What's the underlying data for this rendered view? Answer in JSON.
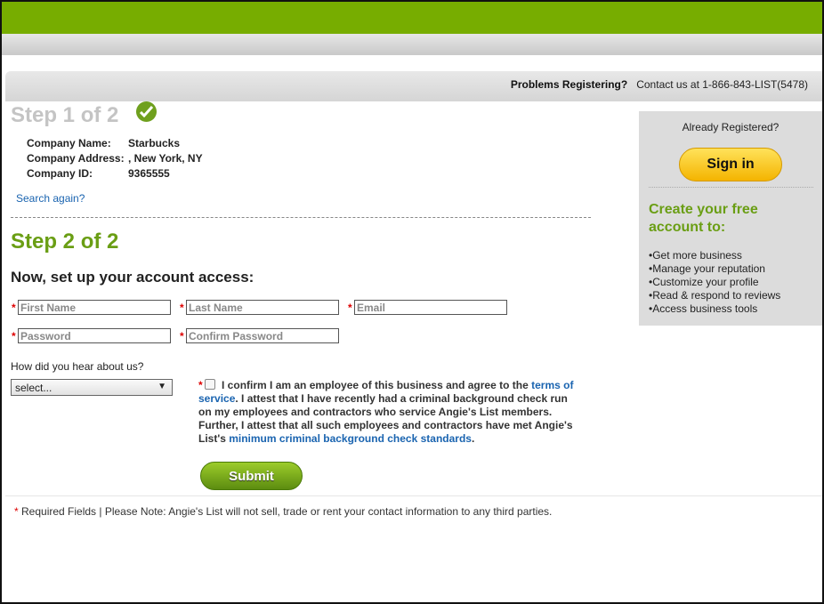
{
  "help": {
    "problems": "Problems Registering?",
    "contact": "Contact us at 1-866-843-LIST(5478)"
  },
  "step1": {
    "title": "Step 1 of 2",
    "company_name_label": "Company Name:",
    "company_name": "Starbucks",
    "company_address_label": "Company Address:",
    "company_address": ", New York, NY",
    "company_id_label": "Company ID:",
    "company_id": "9365555",
    "search_again": "Search again?"
  },
  "step2": {
    "title": "Step 2 of 2",
    "subtitle": "Now, set up your account access:",
    "required_marker": "*",
    "first_name_placeholder": "First Name",
    "last_name_placeholder": "Last Name",
    "email_placeholder": "Email",
    "password_placeholder": "Password",
    "confirm_password_placeholder": "Confirm Password",
    "hear_label": "How did you hear about us?",
    "hear_selected": "select...",
    "confirm_text_1": "I confirm I am an employee of this business and agree to the",
    "terms_link": "terms of service",
    "confirm_text_2": ". I attest that I have recently had a criminal background check run on my employees and contractors who service Angie's List members. Further, I attest that all such employees and contractors have met Angie's List's",
    "standards_link": "minimum criminal background check standards",
    "confirm_text_3": ".",
    "submit": "Submit"
  },
  "footer": {
    "required": "*",
    "note": " Required Fields | Please Note: Angie's List will not sell, trade or rent your contact information to any third parties."
  },
  "sidebar": {
    "already": "Already Registered?",
    "sign_in": "Sign in",
    "create_title": "Create your free account to:",
    "benefits": [
      "Get more business",
      "Manage your reputation",
      "Customize your profile",
      "Read & respond to reviews",
      "Access business tools"
    ]
  },
  "colors": {
    "brand_green": "#77ad00",
    "heading_green": "#6a9e14",
    "link_blue": "#1a64b0",
    "signin_yellow": "#f4b400"
  }
}
